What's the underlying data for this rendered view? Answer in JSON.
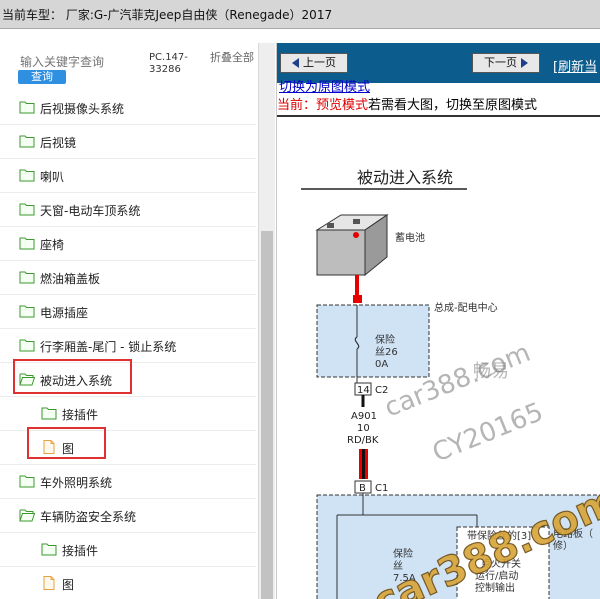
{
  "header": {
    "title": "当前车型：   厂家:G-广汽菲克Jeep自由侠（Renegade）2017"
  },
  "sidebar": {
    "search_placeholder": "输入关键字查询",
    "search_button": "查询",
    "pc_code": "PC.147-33286",
    "collapse_label": "折叠全部",
    "items": [
      {
        "label": "后视摄像头系统",
        "type": "folder",
        "level": 0
      },
      {
        "label": "后视镜",
        "type": "folder",
        "level": 0
      },
      {
        "label": "喇叭",
        "type": "folder",
        "level": 0
      },
      {
        "label": "天窗-电动车顶系统",
        "type": "folder",
        "level": 0
      },
      {
        "label": "座椅",
        "type": "folder",
        "level": 0
      },
      {
        "label": "燃油箱盖板",
        "type": "folder",
        "level": 0
      },
      {
        "label": "电源插座",
        "type": "folder",
        "level": 0
      },
      {
        "label": "行李厢盖-尾门 - 锁止系统",
        "type": "folder",
        "level": 0
      },
      {
        "label": "被动进入系统",
        "type": "folder-open",
        "level": 0,
        "highlighted": true
      },
      {
        "label": "接插件",
        "type": "folder",
        "level": 1
      },
      {
        "label": "图",
        "type": "page",
        "level": 1,
        "highlighted": true
      },
      {
        "label": "车外照明系统",
        "type": "folder",
        "level": 0
      },
      {
        "label": "车辆防盗安全系统",
        "type": "folder-open",
        "level": 0
      },
      {
        "label": "接插件",
        "type": "folder",
        "level": 1
      },
      {
        "label": "图",
        "type": "page",
        "level": 1
      }
    ]
  },
  "viewer": {
    "prev_button": "上一页",
    "next_button": "下一页",
    "refresh_link": "[刷新当",
    "switch_link": "切换为原图模式",
    "mode_prefix": "当前：",
    "mode_name": "预览模式",
    "mode_hint": "若需看大图，切换至原图模式",
    "diagram": {
      "title": "被动进入系统",
      "battery_label": "蓄电池",
      "pdc_label": "总成-配电中心",
      "fuse_label_1": "保险",
      "fuse_label_2": "丝26",
      "fuse_label_3": "0A",
      "conn_pin_top": "14",
      "conn_id_top": "C2",
      "wire_id": "A901",
      "wire_gauge": "10",
      "wire_color": "RD/BK",
      "conn_pin_bottom": "B",
      "conn_id_bottom": "C1",
      "box_fused_label": "带保险丝的[3]",
      "box_board_label_1": "电路板（",
      "box_board_label_2": "修）",
      "ign_label_1": "点火开关",
      "ign_label_2": "运行/启动",
      "ign_label_3": "控制输出",
      "left_fuse_label_1": "保险",
      "left_fuse_label_2": "丝",
      "left_fuse_label_3": "7.5A",
      "watermark_1": "畅易",
      "watermark_2": "car388.com",
      "watermark_3": "CY20165",
      "watermark_4": "car388.com"
    }
  },
  "colors": {
    "toolbar": "#0d5c8e",
    "highlight": "#e03030",
    "mode_red": "#dd0000",
    "link_blue": "#0000cc",
    "fuse_box": "#cfe3f4",
    "connector_red": "#e60000"
  }
}
